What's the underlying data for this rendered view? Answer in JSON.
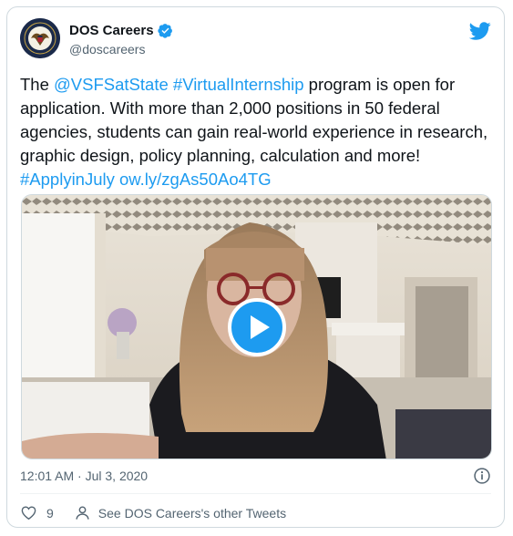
{
  "tweet": {
    "author_name": "DOS Careers",
    "author_handle": "@doscareers",
    "text": {
      "p1": "The ",
      "mention": "@VSFSatState",
      "p2": " ",
      "hashtag1": "#VirtualInternship",
      "p3": " program is open for application. With more than 2,000 positions in 50 federal agencies, students can gain real-world experience in research, graphic design, policy planning, calculation and more! ",
      "hashtag2": "#ApplyinJuly",
      "p4": " ",
      "url": "ow.ly/zgAs50Ao4TG"
    },
    "timestamp": "12:01 AM · Jul 3, 2020",
    "likes": "9",
    "other_tweets_label": "See DOS Careers's other Tweets"
  },
  "colors": {
    "accent": "#1d9bf0",
    "text": "#0f1419",
    "secondary": "#536471",
    "border": "#cfd9de"
  },
  "icons": [
    "seal-avatar",
    "verified-badge-icon",
    "twitter-bird-icon",
    "play-icon",
    "info-icon",
    "heart-icon",
    "person-icon"
  ]
}
